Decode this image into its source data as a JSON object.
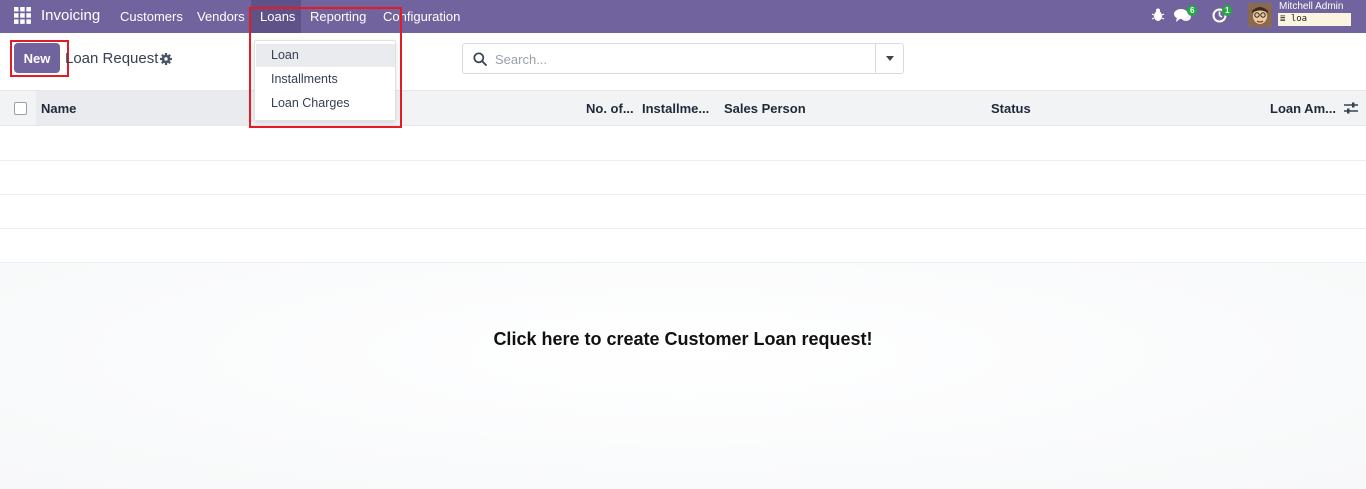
{
  "navbar": {
    "brand": "Invoicing",
    "menu": [
      "Customers",
      "Vendors",
      "Loans",
      "Reporting",
      "Configuration"
    ],
    "activity_badge": "6",
    "clock_badge": "1",
    "user_name": "Mitchell Admin",
    "database": "loa"
  },
  "control_panel": {
    "new_label": "New",
    "breadcrumb": "Loan Request",
    "search_placeholder": "Search..."
  },
  "dropdown": {
    "items": [
      "Loan",
      "Installments",
      "Loan Charges"
    ]
  },
  "list": {
    "columns": [
      "Name",
      "No. of...",
      "Installme...",
      "Sales Person",
      "Status",
      "Loan Am..."
    ]
  },
  "helper": {
    "message": "Click here to create Customer Loan request!"
  },
  "colors": {
    "navbar": "#71639e",
    "highlight_box": "#e31b23",
    "badge": "#28a745"
  }
}
